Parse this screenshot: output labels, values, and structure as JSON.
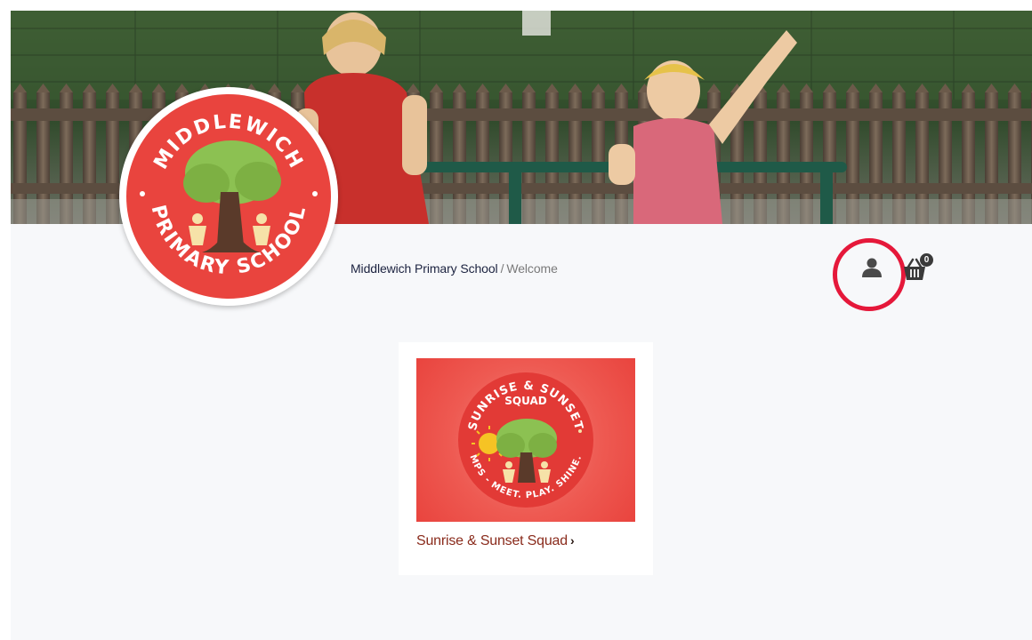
{
  "breadcrumb": {
    "school_link": "Middlewich Primary School",
    "separator": "/",
    "current": "Welcome"
  },
  "header": {
    "account_icon": "user-icon",
    "basket_icon": "basket-icon",
    "basket_count": "0"
  },
  "logo": {
    "icon": "school-logo-tree",
    "text_top": "MIDDLEWICH",
    "text_bottom": "PRIMARY SCHOOL"
  },
  "product": {
    "title": "Sunrise & Sunset Squad",
    "image_icon": "sunrise-sunset-squad-logo",
    "image_text_top": "SUNRISE & SUNSET",
    "image_text_squad": "SQUAD",
    "image_text_bottom": "MPS - MEET. PLAY. SHINE."
  },
  "colors": {
    "brand_red": "#e9443e",
    "highlight_ring": "#e5183a",
    "link_dark": "#1c2340",
    "product_title": "#8a2b1c",
    "page_bg": "#f7f8fa"
  }
}
